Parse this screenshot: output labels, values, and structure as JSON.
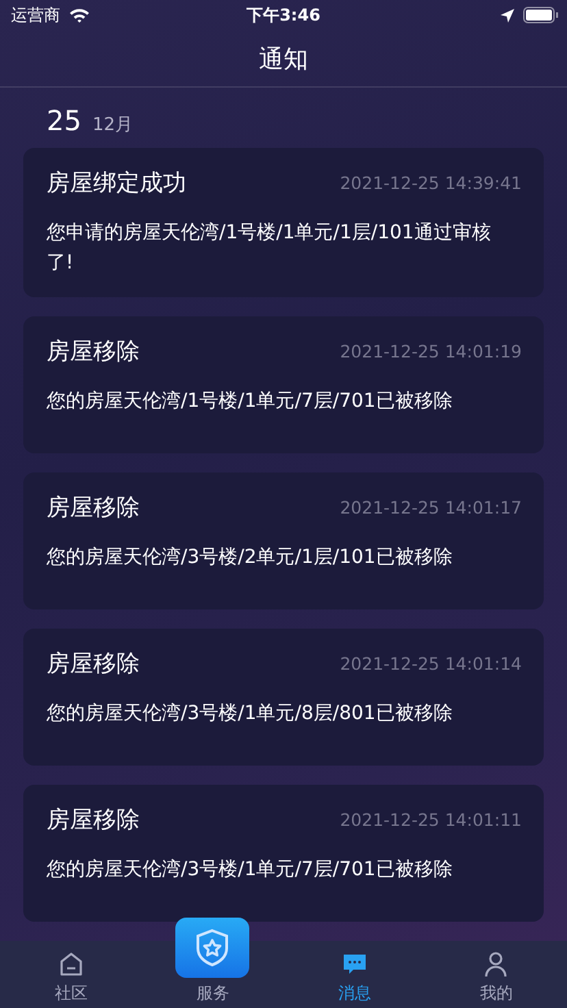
{
  "status_bar": {
    "carrier": "运营商",
    "time": "下午3:46"
  },
  "nav": {
    "title": "通知"
  },
  "date_header": {
    "day": "25",
    "month": "12月"
  },
  "notifications": [
    {
      "title": "房屋绑定成功",
      "time": "2021-12-25 14:39:41",
      "message": "您申请的房屋天伦湾/1号楼/1单元/1层/101通过审核了!"
    },
    {
      "title": "房屋移除",
      "time": "2021-12-25 14:01:19",
      "message": "您的房屋天伦湾/1号楼/1单元/7层/701已被移除"
    },
    {
      "title": "房屋移除",
      "time": "2021-12-25 14:01:17",
      "message": "您的房屋天伦湾/3号楼/2单元/1层/101已被移除"
    },
    {
      "title": "房屋移除",
      "time": "2021-12-25 14:01:14",
      "message": "您的房屋天伦湾/3号楼/1单元/8层/801已被移除"
    },
    {
      "title": "房屋移除",
      "time": "2021-12-25 14:01:11",
      "message": "您的房屋天伦湾/3号楼/1单元/7层/701已被移除"
    }
  ],
  "tab_bar": [
    {
      "kind": "home",
      "label": "社区",
      "selected": false
    },
    {
      "kind": "service",
      "label": "服务",
      "selected": false
    },
    {
      "kind": "message",
      "label": "消息",
      "selected": true
    },
    {
      "kind": "person",
      "label": "我的",
      "selected": false
    }
  ]
}
